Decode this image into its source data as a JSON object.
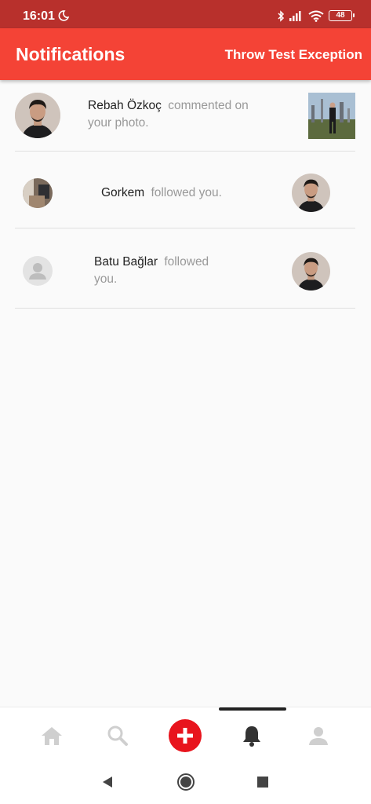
{
  "status_bar": {
    "time": "16:01",
    "battery": "48",
    "icons": [
      "moon-icon",
      "bluetooth-icon",
      "signal-icon",
      "wifi-icon",
      "battery-icon"
    ]
  },
  "app_bar": {
    "title": "Notifications",
    "action_label": "Throw Test Exception",
    "color": "#f44336"
  },
  "notifications": [
    {
      "username": "Rebah Özkoç",
      "message": "commented on your photo.",
      "avatar": "user-photo",
      "right_image": "post-photo"
    },
    {
      "username": "Gorkem",
      "message": "followed you.",
      "avatar": "user-photo",
      "right_image": "user-avatar-photo"
    },
    {
      "username": "Batu Bağlar",
      "message": "followed you.",
      "avatar": "default-avatar-icon",
      "right_image": "user-avatar-photo"
    }
  ],
  "bottom_nav": {
    "items": [
      "home-icon",
      "search-icon",
      "add-icon",
      "bell-icon",
      "person-icon"
    ],
    "active": "bell-icon",
    "accent": "#e8141d"
  },
  "system_nav": {
    "items": [
      "back-icon",
      "home-circle-icon",
      "recents-icon"
    ]
  }
}
